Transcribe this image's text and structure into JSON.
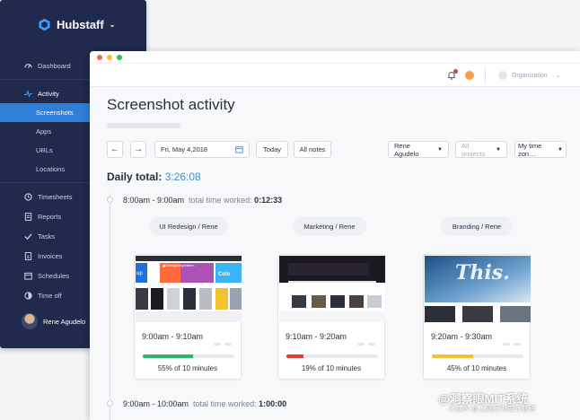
{
  "brand": {
    "name": "Hubstaff",
    "caret": "⌄"
  },
  "sidebar": {
    "items": [
      {
        "label": "Dashboard",
        "icon": "dashboard-icon"
      },
      {
        "label": "Activity",
        "icon": "activity-icon"
      },
      {
        "label": "Screenshots"
      },
      {
        "label": "Apps"
      },
      {
        "label": "URLs"
      },
      {
        "label": "Locations"
      },
      {
        "label": "Timesheets",
        "icon": "timesheets-icon"
      },
      {
        "label": "Reports",
        "icon": "reports-icon"
      },
      {
        "label": "Tasks",
        "icon": "tasks-icon"
      },
      {
        "label": "Invoices",
        "icon": "invoices-icon"
      },
      {
        "label": "Schedules",
        "icon": "schedules-icon"
      },
      {
        "label": "Time off",
        "icon": "time-off-icon"
      }
    ],
    "user": "Rene Agudelo"
  },
  "topbar": {
    "organization": "Organization"
  },
  "page": {
    "title": "Screenshot activity"
  },
  "controls": {
    "prev": "←",
    "next": "→",
    "date": "Fri, May 4,2018",
    "today": "Today",
    "all_notes": "All notes",
    "member": "Rene Agudelo",
    "projects": "All projects",
    "timezone": "My time zon…"
  },
  "daily": {
    "label": "Daily total:",
    "value": "3:26:08"
  },
  "slots": [
    {
      "range": "8:00am - 9:00am",
      "worked_label": "total time worked:",
      "worked": "0:12:33"
    },
    {
      "range": "9:00am - 10:00am",
      "worked_label": "total time worked:",
      "worked": "1:00:00"
    }
  ],
  "cards": [
    {
      "project": "UI Redesign / Rene",
      "time": "9:00am - 9:10am",
      "activity": "55% of 10 minutes",
      "level": 55,
      "color": "#2fb36b"
    },
    {
      "project": "Marketing / Rene",
      "time": "9:10am - 9:20am",
      "activity": "19% of 10 minutes",
      "level": 19,
      "color": "#e53935"
    },
    {
      "project": "Branding / Rene",
      "time": "9:20am - 9:30am",
      "activity": "45% of 10 minutes",
      "level": 45,
      "color": "#f2c230"
    }
  ],
  "thumb_texts": {
    "web": "30designinspiration",
    "color": "Colo",
    "up": "up",
    "this": "This."
  },
  "colors": {
    "sidebar": "#1f2a4d",
    "accent": "#2f7fd8",
    "daily_total": "#3d8fe0"
  },
  "watermark": {
    "line1": "@洞察眼MIT系统",
    "line2": "CSDN @上网行为审计软件"
  }
}
